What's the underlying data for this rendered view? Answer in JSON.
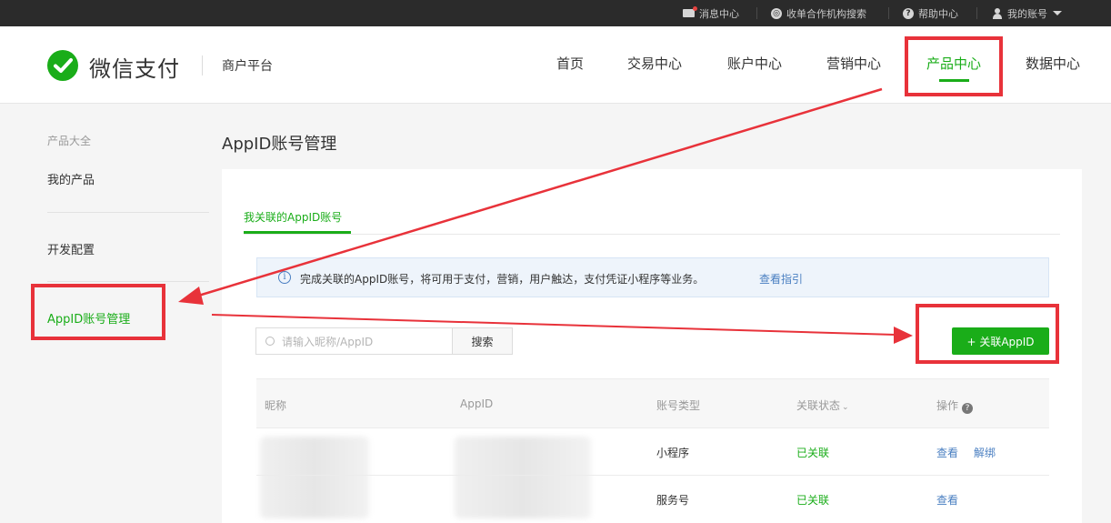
{
  "topbar": {
    "messages": "消息中心",
    "org_search": "收单合作机构搜索",
    "help": "帮助中心",
    "account": "我的账号"
  },
  "header": {
    "logo": "微信支付",
    "platform": "商户平台",
    "nav": [
      "首页",
      "交易中心",
      "账户中心",
      "营销中心",
      "产品中心",
      "数据中心"
    ]
  },
  "sidebar": {
    "group": "产品大全",
    "items": [
      "我的产品",
      "开发配置",
      "AppID账号管理"
    ]
  },
  "main": {
    "title": "AppID账号管理",
    "tab": "我关联的AppID账号",
    "notice": "完成关联的AppID账号，将可用于支付，营销，用户触达，支付凭证小程序等业务。",
    "notice_link": "查看指引",
    "search_placeholder": "请输入昵称/AppID",
    "search_button": "搜索",
    "add_button": "+ 关联AppID"
  },
  "table": {
    "columns": [
      "昵称",
      "AppID",
      "账号类型",
      "关联状态",
      "操作"
    ],
    "rows": [
      {
        "type": "小程序",
        "status": "已关联",
        "actions": [
          "查看",
          "解绑"
        ]
      },
      {
        "type": "服务号",
        "status": "已关联",
        "actions": [
          "查看"
        ]
      }
    ]
  },
  "colors": {
    "brand_green": "#1aad19",
    "annotation_red": "#e8323a",
    "link_blue": "#4a7fc1"
  }
}
